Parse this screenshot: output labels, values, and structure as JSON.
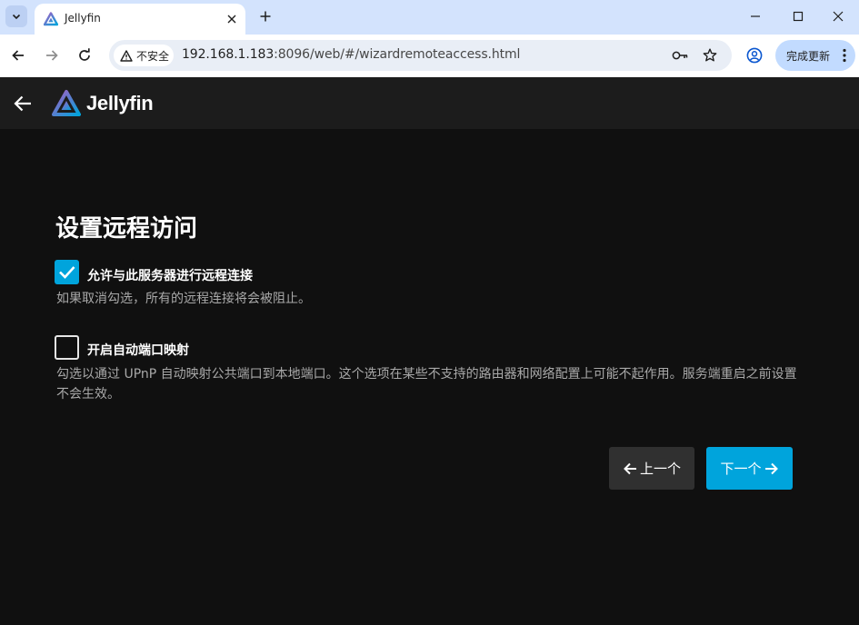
{
  "browser": {
    "tab_title": "Jellyfin",
    "security_label": "不安全",
    "url_host": "192.168.1.183",
    "url_rest": ":8096/web/#/wizardremoteaccess.html",
    "update_label": "完成更新"
  },
  "app": {
    "brand": "Jellyfin"
  },
  "page": {
    "title": "设置远程访问",
    "remote_access": {
      "label": "允许与此服务器进行远程连接",
      "checked": true,
      "help": "如果取消勾选，所有的远程连接将会被阻止。"
    },
    "port_mapping": {
      "label": "开启自动端口映射",
      "checked": false,
      "help": "勾选以通过 UPnP 自动映射公共端口到本地端口。这个选项在某些不支持的路由器和网络配置上可能不起作用。服务端重启之前设置不会生效。"
    },
    "buttons": {
      "prev": "上一个",
      "next": "下一个"
    }
  },
  "colors": {
    "accent": "#00a4dc",
    "background": "#101010",
    "header": "#1c1c1c"
  },
  "icons": [
    "chevron-down-icon",
    "jellyfin-logo-icon",
    "close-icon",
    "plus-icon",
    "minimize-icon",
    "maximize-icon",
    "back-icon",
    "forward-icon",
    "reload-icon",
    "warning-icon",
    "key-icon",
    "star-icon",
    "profile-icon",
    "kebab-icon",
    "arrow-left-icon",
    "arrow-right-icon",
    "check-icon"
  ]
}
